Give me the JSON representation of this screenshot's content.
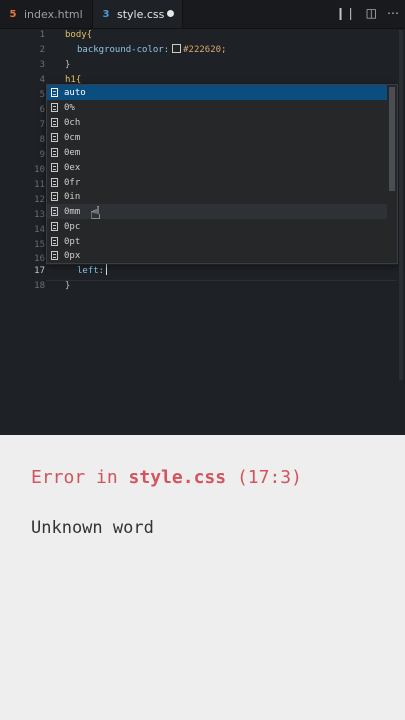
{
  "tabs": [
    {
      "label": "index.html",
      "icon": "html5-icon"
    },
    {
      "label": "style.css",
      "icon": "css3-icon",
      "unsaved": true
    }
  ],
  "code": [
    {
      "n": "1",
      "text": "body{"
    },
    {
      "n": "2",
      "prop": "background-color:",
      "val": "#222620;"
    },
    {
      "n": "3",
      "text": "}"
    },
    {
      "n": "4",
      "text": "h1{"
    },
    {
      "n": "5"
    },
    {
      "n": "6"
    },
    {
      "n": "7"
    },
    {
      "n": "8"
    },
    {
      "n": "9"
    },
    {
      "n": "10"
    },
    {
      "n": "11"
    },
    {
      "n": "12"
    },
    {
      "n": "13"
    },
    {
      "n": "14"
    },
    {
      "n": "15"
    },
    {
      "n": "16"
    },
    {
      "n": "17",
      "prop": "left:"
    },
    {
      "n": "18",
      "text": "}"
    }
  ],
  "suggestions": [
    "auto",
    "0%",
    "0ch",
    "0cm",
    "0em",
    "0ex",
    "0fr",
    "0in",
    "0mm",
    "0pc",
    "0pt",
    "0px"
  ],
  "error": {
    "prefix": "Error in",
    "file": "style.css",
    "location": "(17:3)",
    "message": "Unknown word"
  }
}
